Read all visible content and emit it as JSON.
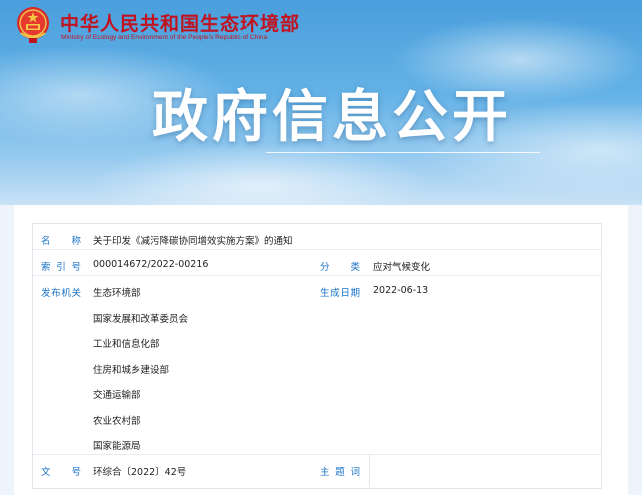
{
  "header": {
    "ministry_cn": "中华人民共和国生态环境部",
    "ministry_en": "Ministry of Ecology and Environment of the People's Republic of China",
    "emblem_icon": "national-emblem-icon",
    "brand_color": "#c1121f"
  },
  "banner": {
    "title": "政府信息公开"
  },
  "info": {
    "name_label": "名　称",
    "name_value": "关于印发《减污降碳协同增效实施方案》的通知",
    "index_label": "索引号",
    "index_value": "000014672/2022-00216",
    "category_label": "分　类",
    "category_value": "应对气候变化",
    "issuer_label": "发布机关",
    "issuers": [
      "生态环境部",
      "国家发展和改革委员会",
      "工业和信息化部",
      "住房和城乡建设部",
      "交通运输部",
      "农业农村部",
      "国家能源局"
    ],
    "date_label": "生成日期",
    "date_value": "2022-06-13",
    "docnum_label": "文　号",
    "docnum_value": "环综合〔2022〕42号",
    "subject_label": "主题词",
    "subject_value": ""
  },
  "colors": {
    "label": "#1a73c7",
    "text": "#222222"
  }
}
